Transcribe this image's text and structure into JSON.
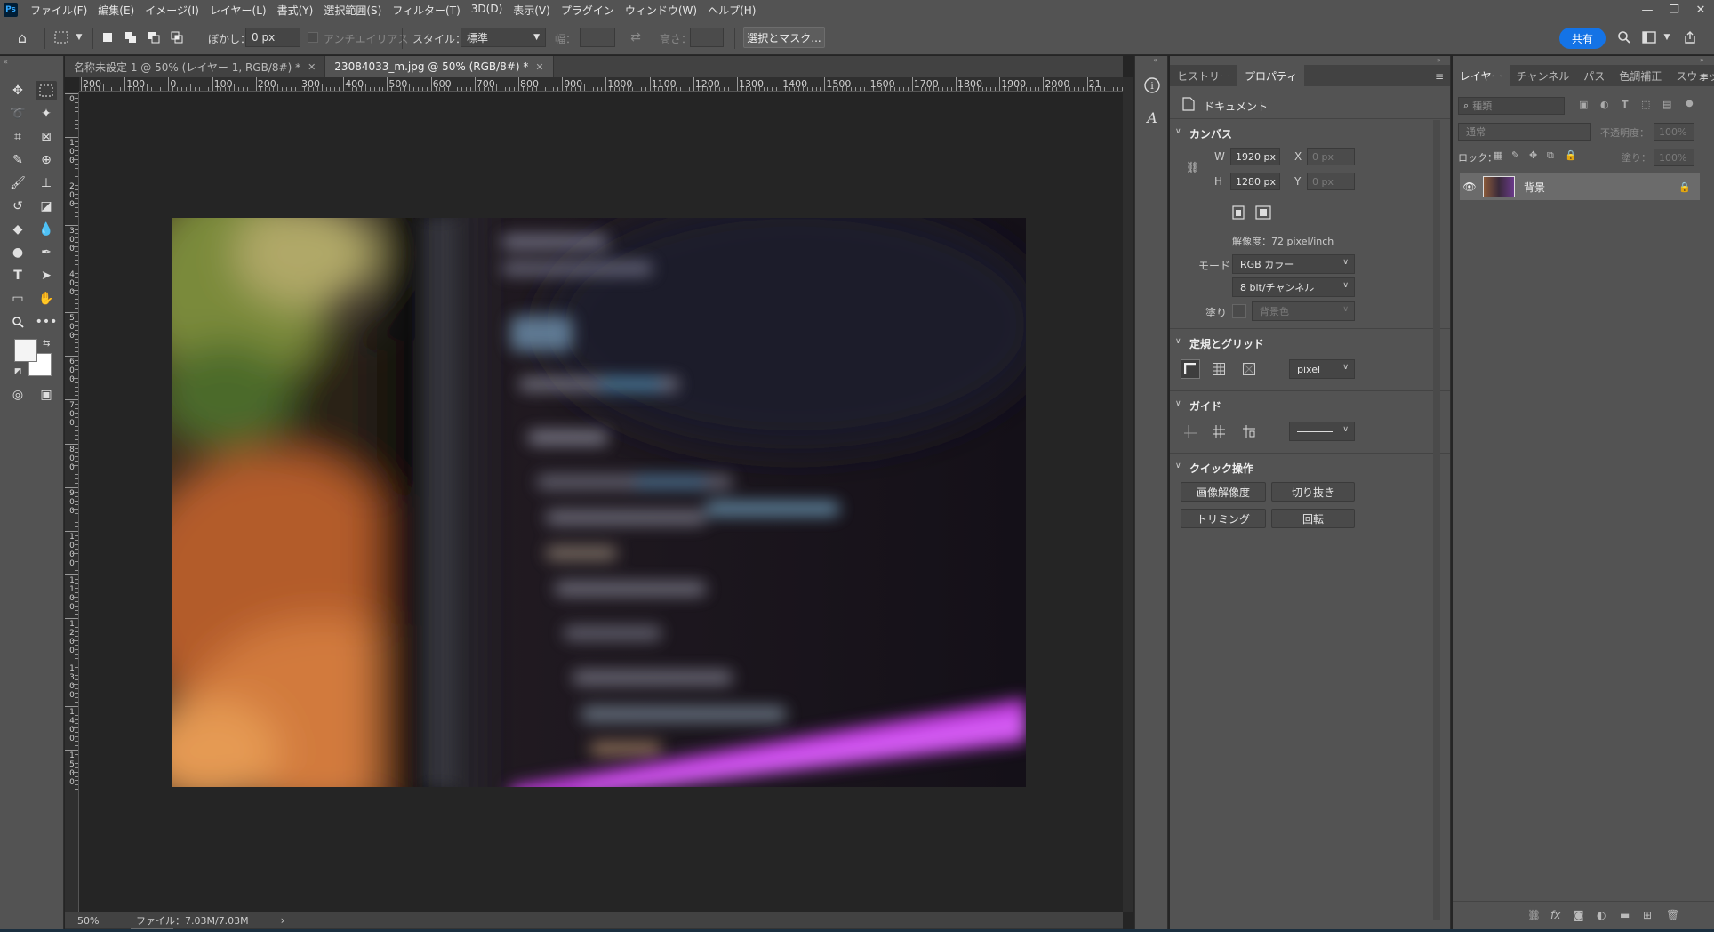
{
  "app": {
    "logo": "Ps",
    "menu": [
      "ファイル(F)",
      "編集(E)",
      "イメージ(I)",
      "レイヤー(L)",
      "書式(Y)",
      "選択範囲(S)",
      "フィルター(T)",
      "3D(D)",
      "表示(V)",
      "プラグイン",
      "ウィンドウ(W)",
      "ヘルプ(H)"
    ]
  },
  "options": {
    "feather_label": "ぼかし：",
    "feather_value": "0 px",
    "antialias_label": "アンチエイリアス",
    "style_label": "スタイル：",
    "style_value": "標準",
    "width_label": "幅：",
    "height_label": "高さ：",
    "select_mask_label": "選択とマスク...",
    "share_label": "共有"
  },
  "tabs": [
    {
      "label": "名称未設定 1 @ 50% (レイヤー 1, RGB/8#) *",
      "active": false
    },
    {
      "label": "23084033_m.jpg @ 50% (RGB/8#) *",
      "active": true
    }
  ],
  "ruler_top": [
    "200",
    "100",
    "0",
    "100",
    "200",
    "300",
    "400",
    "500",
    "600",
    "700",
    "800",
    "900",
    "1000",
    "1100",
    "1200",
    "1300",
    "1400",
    "1500",
    "1600",
    "1700",
    "1800",
    "1900",
    "2000",
    "21"
  ],
  "ruler_left": [
    "0",
    "1\n0\n0",
    "2\n0\n0",
    "3\n0\n0",
    "4\n0\n0",
    "5\n0\n0",
    "6\n0\n0",
    "7\n0\n0",
    "8\n0\n0",
    "9\n0\n0",
    "1\n0\n0\n0",
    "1\n1\n0\n0",
    "1\n2\n0\n0",
    "1\n3\n0\n0",
    "1\n4\n0\n0",
    "1\n5\n0\n0"
  ],
  "status": {
    "zoom": "50%",
    "file_info": "ファイル：7.03M/7.03M"
  },
  "properties": {
    "tabs": [
      "ヒストリー",
      "プロパティ"
    ],
    "doc_label": "ドキュメント",
    "canvas_title": "カンバス",
    "w_label": "W",
    "w_value": "1920 px",
    "h_label": "H",
    "h_value": "1280 px",
    "x_label": "X",
    "x_value": "0 px",
    "y_label": "Y",
    "y_value": "0 px",
    "resolution": "解像度：72 pixel/inch",
    "mode_label": "モード",
    "mode_value": "RGB カラー",
    "bit_value": "8 bit/チャンネル",
    "fill_label": "塗り",
    "fill_value": "背景色",
    "rulers_title": "定規とグリッド",
    "ruler_unit": "pixel",
    "guides_title": "ガイド",
    "quick_title": "クイック操作",
    "btn_image_size": "画像解像度",
    "btn_crop": "切り抜き",
    "btn_trim": "トリミング",
    "btn_rotate": "回転"
  },
  "layers": {
    "tabs": [
      "レイヤー",
      "チャンネル",
      "パス",
      "色調補正",
      "スウォッチ"
    ],
    "search_placeholder": "種類",
    "blend_mode": "通常",
    "opacity_label": "不透明度：",
    "opacity_value": "100%",
    "lock_label": "ロック：",
    "fill_label": "塗り：",
    "fill_value": "100%",
    "layer_name": "背景"
  },
  "colors": {
    "accent": "#1473e6",
    "panel": "#535353",
    "canvas_bg": "#252525"
  }
}
